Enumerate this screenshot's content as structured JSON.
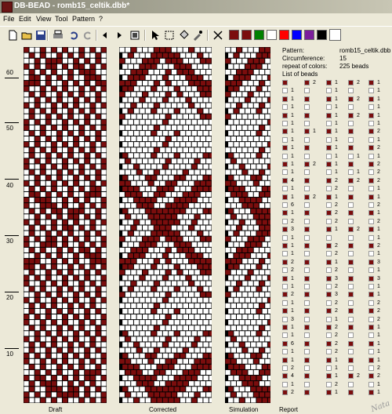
{
  "app": {
    "title": "DB-BEAD - romb15_celtik.dbb*"
  },
  "menu": [
    "File",
    "Edit",
    "View",
    "Tool",
    "Pattern",
    "?"
  ],
  "toolbar": {
    "icons": [
      "new-file-icon",
      "open-folder-icon",
      "save-icon",
      "print-icon",
      "undo-icon",
      "redo-icon",
      "arrow-left-icon",
      "arrow-right-icon",
      "preview-icon",
      "pointer-icon",
      "select-rect-icon",
      "fill-icon",
      "eyedropper-icon",
      "erase-icon"
    ],
    "colors": [
      "#7b0d0d",
      "#7b0d0d",
      "#008000",
      "#ffffff",
      "#ff0000",
      "#0000ff",
      "#7b1e9b",
      "#000000",
      "#ffffff"
    ]
  },
  "ruler": {
    "labels": [
      "60",
      "50",
      "40",
      "30",
      "20",
      "10"
    ]
  },
  "panels": {
    "draft": "Draft",
    "corrected": "Corrected",
    "simulation": "Simulation",
    "report": "Report"
  },
  "info": {
    "pattern_label": "Pattern:",
    "pattern_value": "romb15_celtik.dbb",
    "circ_label": "Circumference:",
    "circ_value": "15",
    "repeat_label": "repeat of colors:",
    "repeat_value": "225 beads",
    "list_label": "List of beads"
  },
  "colors": {
    "bead": "#7b0d0d",
    "white": "#ffffff"
  },
  "bead_list": [
    [
      null,
      "2",
      "1",
      "2",
      "1"
    ],
    [
      "1",
      null,
      "1",
      null,
      "1"
    ],
    [
      "1",
      null,
      "1",
      "2",
      "1"
    ],
    [
      "1",
      null,
      "1",
      null,
      "1"
    ],
    [
      "1",
      null,
      "1",
      "2",
      "1"
    ],
    [
      "1",
      null,
      "1",
      null,
      "1"
    ],
    [
      "1",
      "1",
      "1",
      null,
      "2"
    ],
    [
      "1",
      null,
      "1",
      null,
      "1"
    ],
    [
      "1",
      null,
      "1",
      null,
      "2"
    ],
    [
      "1",
      null,
      "1",
      "1",
      "1"
    ],
    [
      "1",
      "2",
      "1",
      null,
      "2"
    ],
    [
      "1",
      null,
      "1",
      "1",
      "2"
    ],
    [
      "4",
      null,
      "2",
      "2",
      "2"
    ],
    [
      "1",
      null,
      "2",
      null,
      "1"
    ],
    [
      "1",
      "2",
      "1",
      null,
      "1"
    ],
    [
      "6",
      null,
      "2",
      null,
      "2"
    ],
    [
      "1",
      null,
      "2",
      null,
      "1"
    ],
    [
      "2",
      null,
      "2",
      null,
      "2"
    ],
    [
      "3",
      null,
      "1",
      "2",
      "1"
    ],
    [
      "1",
      null,
      null,
      null,
      "1"
    ],
    [
      "1",
      null,
      "2",
      null,
      "2"
    ],
    [
      "1",
      null,
      "2",
      null,
      "1"
    ],
    [
      "2",
      null,
      "1",
      null,
      "3"
    ],
    [
      "2",
      null,
      "2",
      null,
      "1"
    ],
    [
      "1",
      null,
      "3",
      null,
      "3"
    ],
    [
      "1",
      null,
      "2",
      null,
      "1"
    ],
    [
      "2",
      null,
      "3",
      null,
      "1"
    ],
    [
      "1",
      null,
      "2",
      null,
      "2"
    ],
    [
      "1",
      null,
      "2",
      null,
      "2"
    ],
    [
      "3",
      null,
      "1",
      null,
      "2"
    ],
    [
      "1",
      null,
      "2",
      null,
      "1"
    ],
    [
      "1",
      null,
      "2",
      null,
      "1"
    ],
    [
      "6",
      null,
      "2",
      null,
      "1"
    ],
    [
      "1",
      null,
      "2",
      null,
      "1"
    ],
    [
      "1",
      null,
      "1",
      null,
      "1"
    ],
    [
      "2",
      null,
      "1",
      null,
      "2"
    ],
    [
      "4",
      null,
      "1",
      "2",
      "2"
    ],
    [
      "1",
      null,
      "2",
      null,
      "1"
    ],
    [
      "2",
      null,
      "1",
      null,
      "1"
    ]
  ]
}
